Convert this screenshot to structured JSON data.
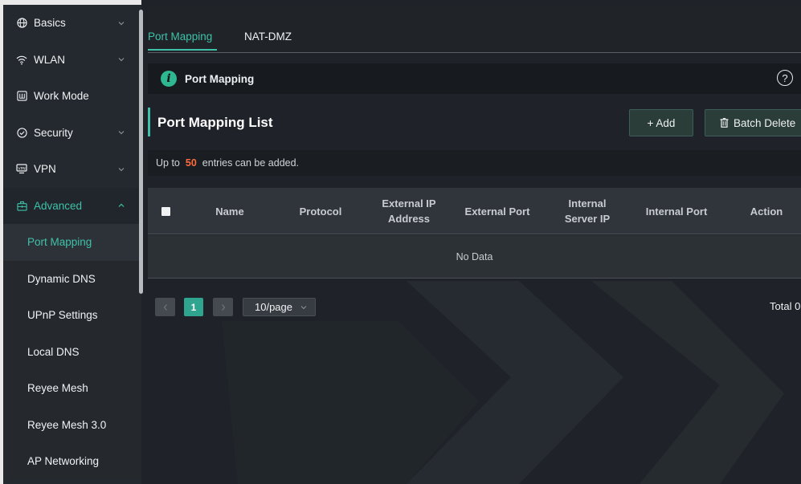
{
  "sidebar": {
    "items": [
      {
        "label": "Basics",
        "icon": "globe-icon"
      },
      {
        "label": "WLAN",
        "icon": "wifi-icon"
      },
      {
        "label": "Work Mode",
        "icon": "work-mode-icon"
      },
      {
        "label": "Security",
        "icon": "shield-check-icon"
      },
      {
        "label": "VPN",
        "icon": "vpn-icon"
      },
      {
        "label": "Advanced",
        "icon": "advanced-icon"
      }
    ],
    "sub_items": [
      "Port Mapping",
      "Dynamic DNS",
      "UPnP Settings",
      "Local DNS",
      "Reyee Mesh",
      "Reyee Mesh 3.0",
      "AP Networking"
    ]
  },
  "tabs": [
    "Port Mapping",
    "NAT-DMZ"
  ],
  "info": {
    "icon_text": "i",
    "title": "Port Mapping",
    "help_icon_text": "?"
  },
  "list": {
    "title": "Port Mapping List",
    "add_label": "+ Add",
    "batch_delete_label": "Batch Delete",
    "note_prefix": "Up to",
    "note_count": "50",
    "note_suffix": "entries can be added."
  },
  "table": {
    "columns": [
      "Name",
      "Protocol",
      "External IP Address",
      "External Port",
      "Internal Server IP",
      "Internal Port",
      "Action"
    ],
    "empty_text": "No Data"
  },
  "pagination": {
    "current_page": "1",
    "page_size": "10/page",
    "total": "Total 0"
  },
  "colors": {
    "accent": "#3ec1a8",
    "highlight_number": "#ff6a3d",
    "background": "#1f2329"
  }
}
